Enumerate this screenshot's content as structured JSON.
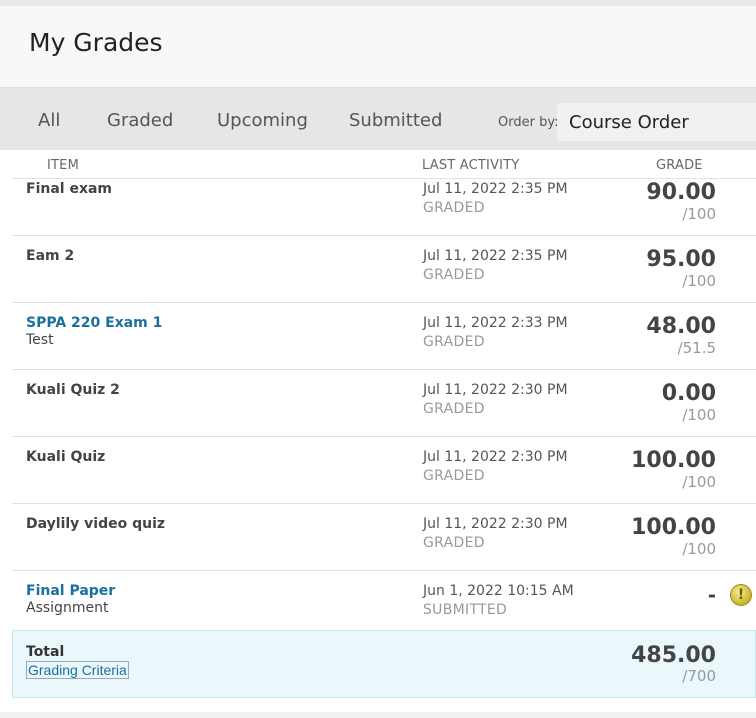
{
  "header": {
    "title": "My Grades"
  },
  "filters": {
    "tabs": [
      {
        "label": "All"
      },
      {
        "label": "Graded"
      },
      {
        "label": "Upcoming"
      },
      {
        "label": "Submitted"
      }
    ],
    "order_label": "Order by:",
    "order_value": "Course Order"
  },
  "columns": {
    "item": "ITEM",
    "activity": "LAST ACTIVITY",
    "grade": "GRADE"
  },
  "rows": [
    {
      "name": "Final exam",
      "sub": "",
      "date": "Jul 11, 2022 2:35 PM",
      "status": "GRADED",
      "score": "90.00",
      "max": "/100"
    },
    {
      "name": "Eam 2",
      "sub": "",
      "date": "Jul 11, 2022 2:35 PM",
      "status": "GRADED",
      "score": "95.00",
      "max": "/100"
    },
    {
      "name": "SPPA 220 Exam 1",
      "sub": "Test",
      "date": "Jul 11, 2022 2:33 PM",
      "status": "GRADED",
      "score": "48.00",
      "max": "/51.5"
    },
    {
      "name": "Kuali Quiz 2",
      "sub": "",
      "date": "Jul 11, 2022 2:30 PM",
      "status": "GRADED",
      "score": "0.00",
      "max": "/100"
    },
    {
      "name": "Kuali Quiz",
      "sub": "",
      "date": "Jul 11, 2022 2:30 PM",
      "status": "GRADED",
      "score": "100.00",
      "max": "/100"
    },
    {
      "name": "Daylily video quiz",
      "sub": "",
      "date": "Jul 11, 2022 2:30 PM",
      "status": "GRADED",
      "score": "100.00",
      "max": "/100"
    },
    {
      "name": "Final Paper",
      "sub": "Assignment",
      "date": "Jun 1, 2022 10:15 AM",
      "status": "SUBMITTED",
      "score": "-",
      "max": ""
    }
  ],
  "total": {
    "label": "Total",
    "criteria_link": "Grading Criteria",
    "score": "485.00",
    "max": "/700"
  }
}
